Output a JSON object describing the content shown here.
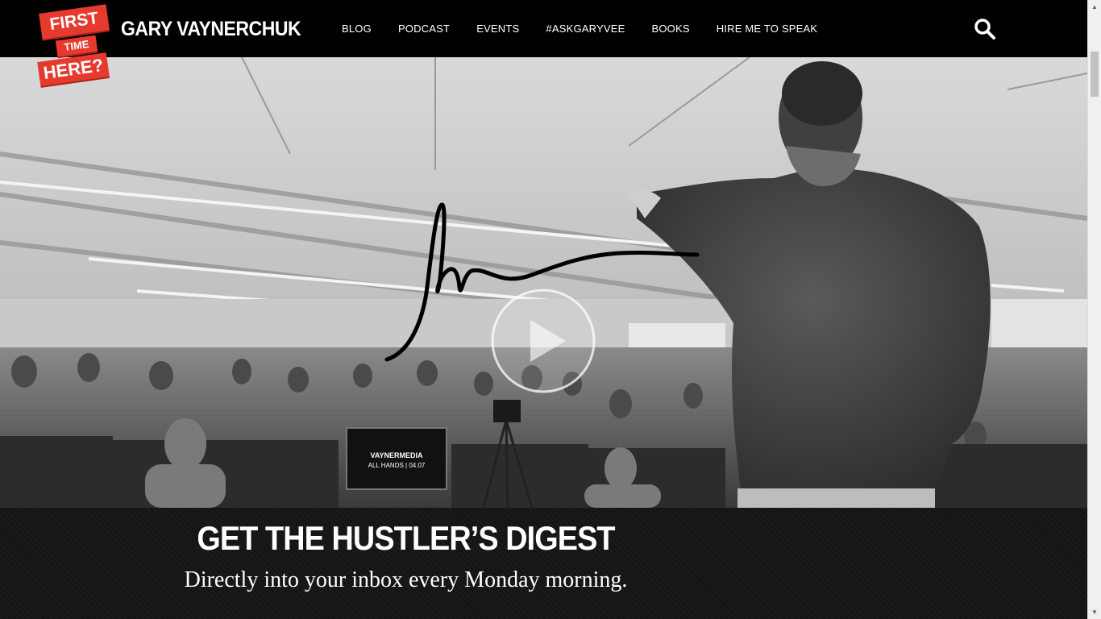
{
  "badge": {
    "line1": "FIRST",
    "line2": "TIME",
    "line3": "HERE?"
  },
  "brand": {
    "name": "GARY VAYNERCHUK"
  },
  "nav": {
    "items": [
      {
        "label": "BLOG"
      },
      {
        "label": "PODCAST"
      },
      {
        "label": "EVENTS"
      },
      {
        "label": "#ASKGARYVEE"
      },
      {
        "label": "BOOKS"
      },
      {
        "label": "HIRE ME TO SPEAK"
      }
    ],
    "search_icon": "search-icon"
  },
  "hero": {
    "monitor_text_line1": "VAYNERMEDIA",
    "monitor_text_line2": "ALL HANDS | 04.07",
    "play_icon": "play-icon",
    "signature_icon": "signature-icon"
  },
  "digest": {
    "title": "GET THE HUSTLER’S DIGEST",
    "subtitle": "Directly into your inbox every Monday morning."
  },
  "colors": {
    "badge_red": "#e63a2e",
    "header_bg": "#000000",
    "digest_bg": "#151515"
  }
}
